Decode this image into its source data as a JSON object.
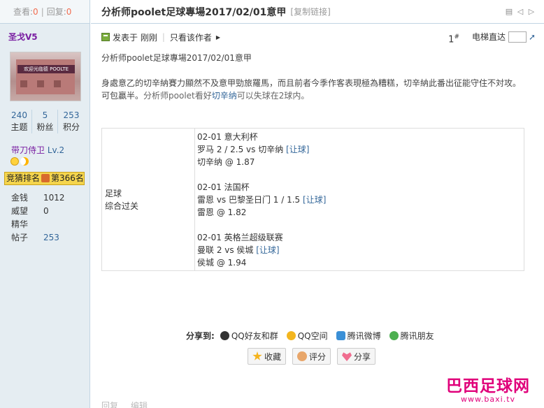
{
  "sidebar": {
    "views_label": "查看:",
    "views": "0",
    "sep": "|",
    "replies_label": "回复:",
    "replies": "0",
    "username": "圣戈V5",
    "avatar_text": "欢迎光临德 POOLTE",
    "stats": [
      {
        "value": "240",
        "label": "主题"
      },
      {
        "value": "5",
        "label": "粉丝"
      },
      {
        "value": "253",
        "label": "积分"
      }
    ],
    "rank": "带刀侍卫",
    "level": "Lv.2",
    "badge_a": "竞猜排名",
    "badge_b": "第366名",
    "info": [
      {
        "k": "金钱",
        "v": "1012"
      },
      {
        "k": "威望",
        "v": "0"
      },
      {
        "k": "精华",
        "v": ""
      },
      {
        "k": "帖子",
        "v": "253"
      }
    ]
  },
  "post": {
    "title": "分析师poolet足球專場2017/02/01意甲",
    "copy_link": "[复制链接]",
    "posted": "发表于 刚刚",
    "only_author": "只看该作者",
    "floor_num": "1",
    "floor_sup": "#",
    "elevator": "电梯直达",
    "line1": "分析师poolet足球專場2017/02/01意甲",
    "line2a": "身處意乙的切辛納賽力顯然不及意甲勁旅羅馬，而且前者今季作客表現極為糟糕，切辛納此番出征能守住不対攻。可包贏半。",
    "line2b": "分析师poolet看好",
    "line2c": "切辛纳",
    "line2d": "可以失球在2球内。",
    "tip_label1": "足球",
    "tip_label2": "综合过关",
    "tips": [
      {
        "date": "02-01  意大利杯",
        "match": "罗马 2 / 2.5 vs 切辛纳  ",
        "link": "[让球]",
        "pick": "切辛纳 @ 1.87"
      },
      {
        "date": "02-01  法国杯",
        "match": "雷恩 vs 巴黎圣日门 1 / 1.5 ",
        "link": "[让球]",
        "pick": "雷恩 @ 1.82"
      },
      {
        "date": "02-01  英格兰超级联赛",
        "match": "曼联 2 vs 侯城  ",
        "link": "[让球]",
        "pick": "侯城 @ 1.94"
      }
    ],
    "share_label": "分享到:",
    "share": [
      "QQ好友和群",
      "QQ空间",
      "腾讯微博",
      "腾讯朋友"
    ],
    "buttons": [
      "收藏",
      "评分",
      "分享"
    ],
    "bottom": [
      "回复",
      "编辑"
    ]
  },
  "watermark": {
    "line1": "巴西足球网",
    "line2": "www.baxi.tv"
  },
  "colors": {
    "accent": "#336699",
    "name": "#7a1fa2",
    "sidebar_bg": "#e5edf2",
    "border": "#c2d5e3",
    "badge": "#f5d54d",
    "watermark": "#e0007a"
  }
}
